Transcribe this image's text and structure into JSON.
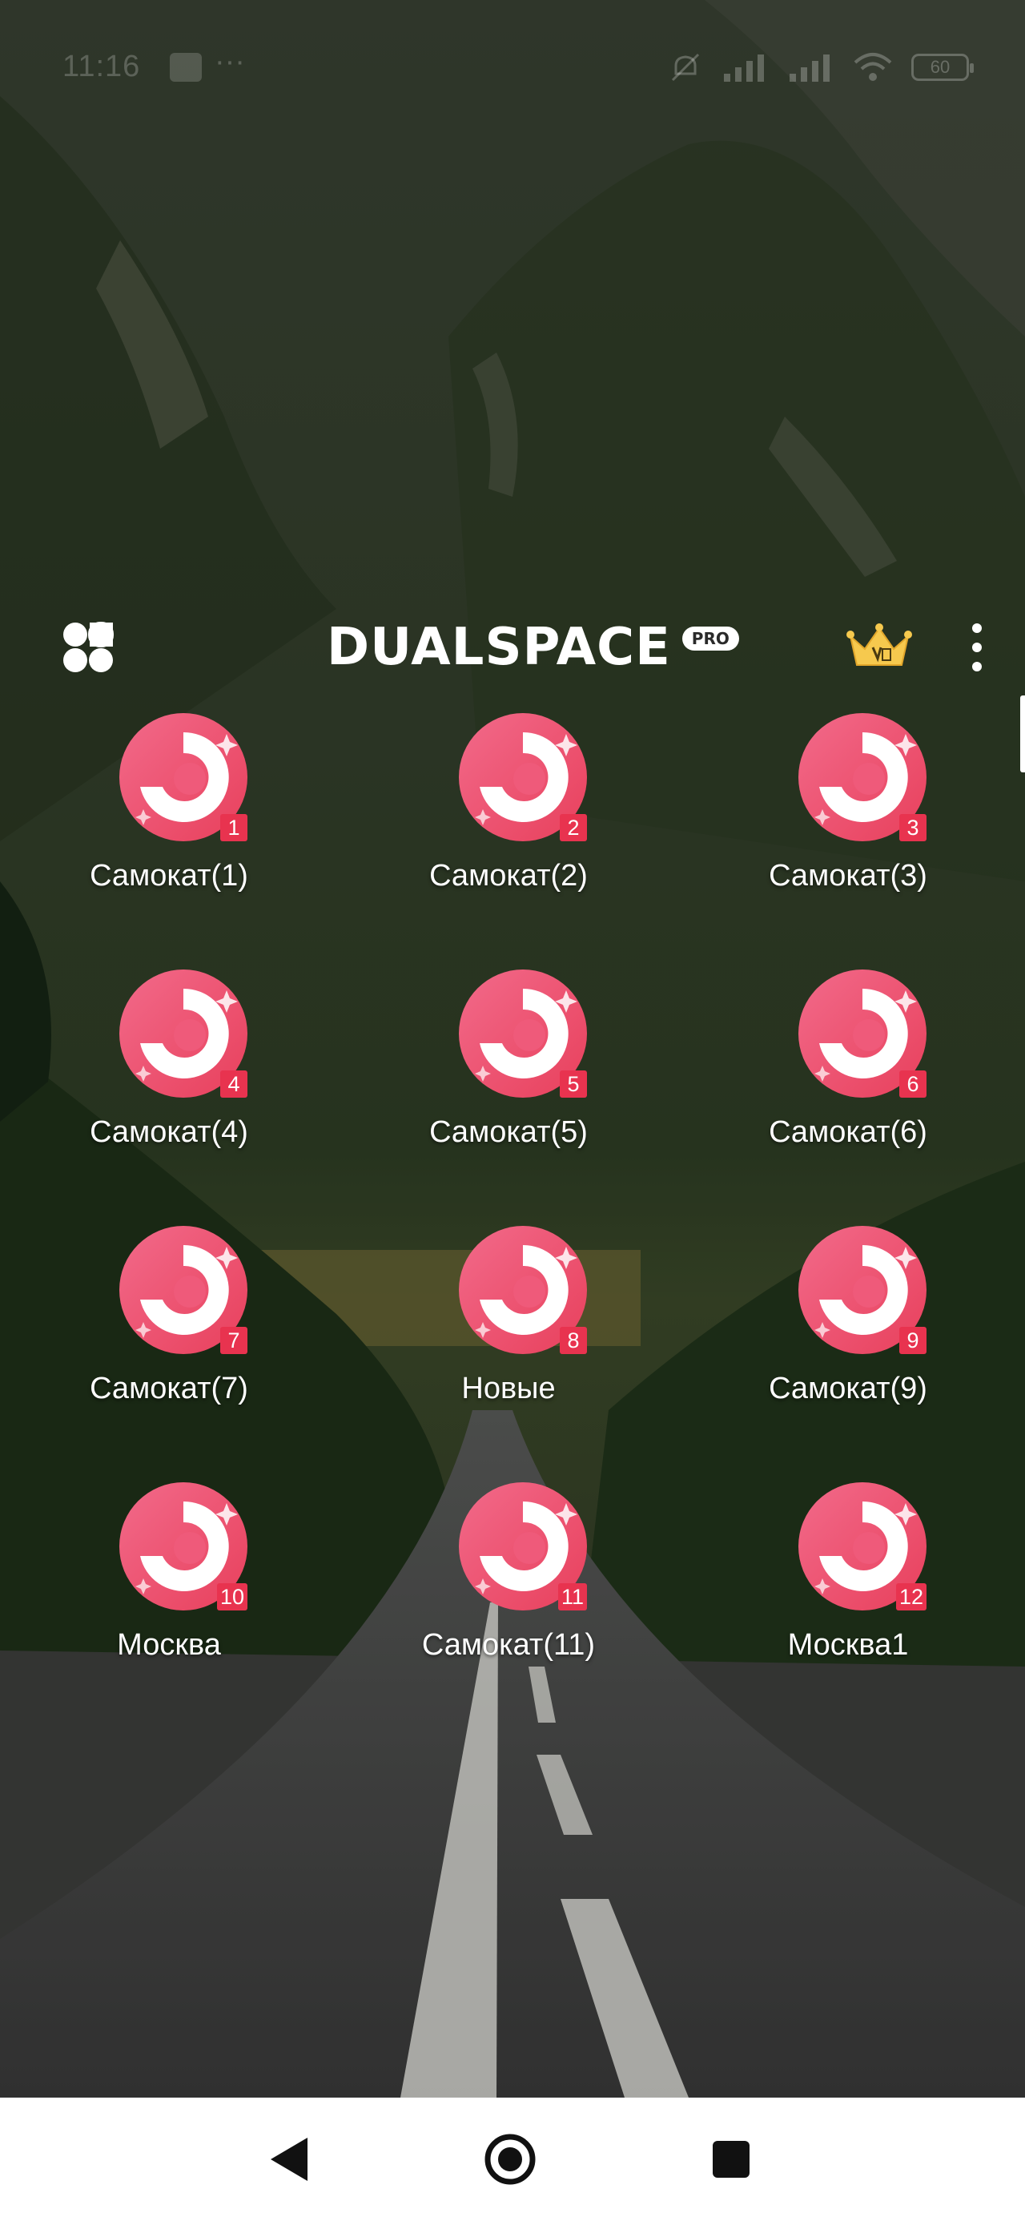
{
  "status_bar": {
    "time": "11:16",
    "battery": "60",
    "icons": [
      "notification-icon",
      "mute-icon",
      "signal-icon",
      "signal-icon",
      "wifi-icon",
      "battery-icon"
    ]
  },
  "header": {
    "logo_text": "DUALSPACE",
    "logo_badge": "PRO",
    "left_icon": "menu-grid-icon",
    "vip_icon": "vip-crown-icon",
    "more_icon": "more-vertical-icon"
  },
  "apps": [
    {
      "label": "Самокат(1)",
      "badge": "1"
    },
    {
      "label": "Самокат(2)",
      "badge": "2"
    },
    {
      "label": "Самокат(3)",
      "badge": "3"
    },
    {
      "label": "Самокат(4)",
      "badge": "4"
    },
    {
      "label": "Самокат(5)",
      "badge": "5"
    },
    {
      "label": "Самокат(6)",
      "badge": "6"
    },
    {
      "label": "Самокат(7)",
      "badge": "7"
    },
    {
      "label": "Новые",
      "badge": "8"
    },
    {
      "label": "Самокат(9)",
      "badge": "9"
    },
    {
      "label": "Москва",
      "badge": "10"
    },
    {
      "label": "Самокат(11)",
      "badge": "11"
    },
    {
      "label": "Москва1",
      "badge": "12"
    }
  ],
  "navigation": {
    "back_icon": "back-icon",
    "home_icon": "home-icon",
    "recents_icon": "recents-icon"
  },
  "colors": {
    "app_icon_pink": "#f05a7a",
    "badge_red": "#e8334f",
    "navbar_bg": "#ffffff"
  }
}
